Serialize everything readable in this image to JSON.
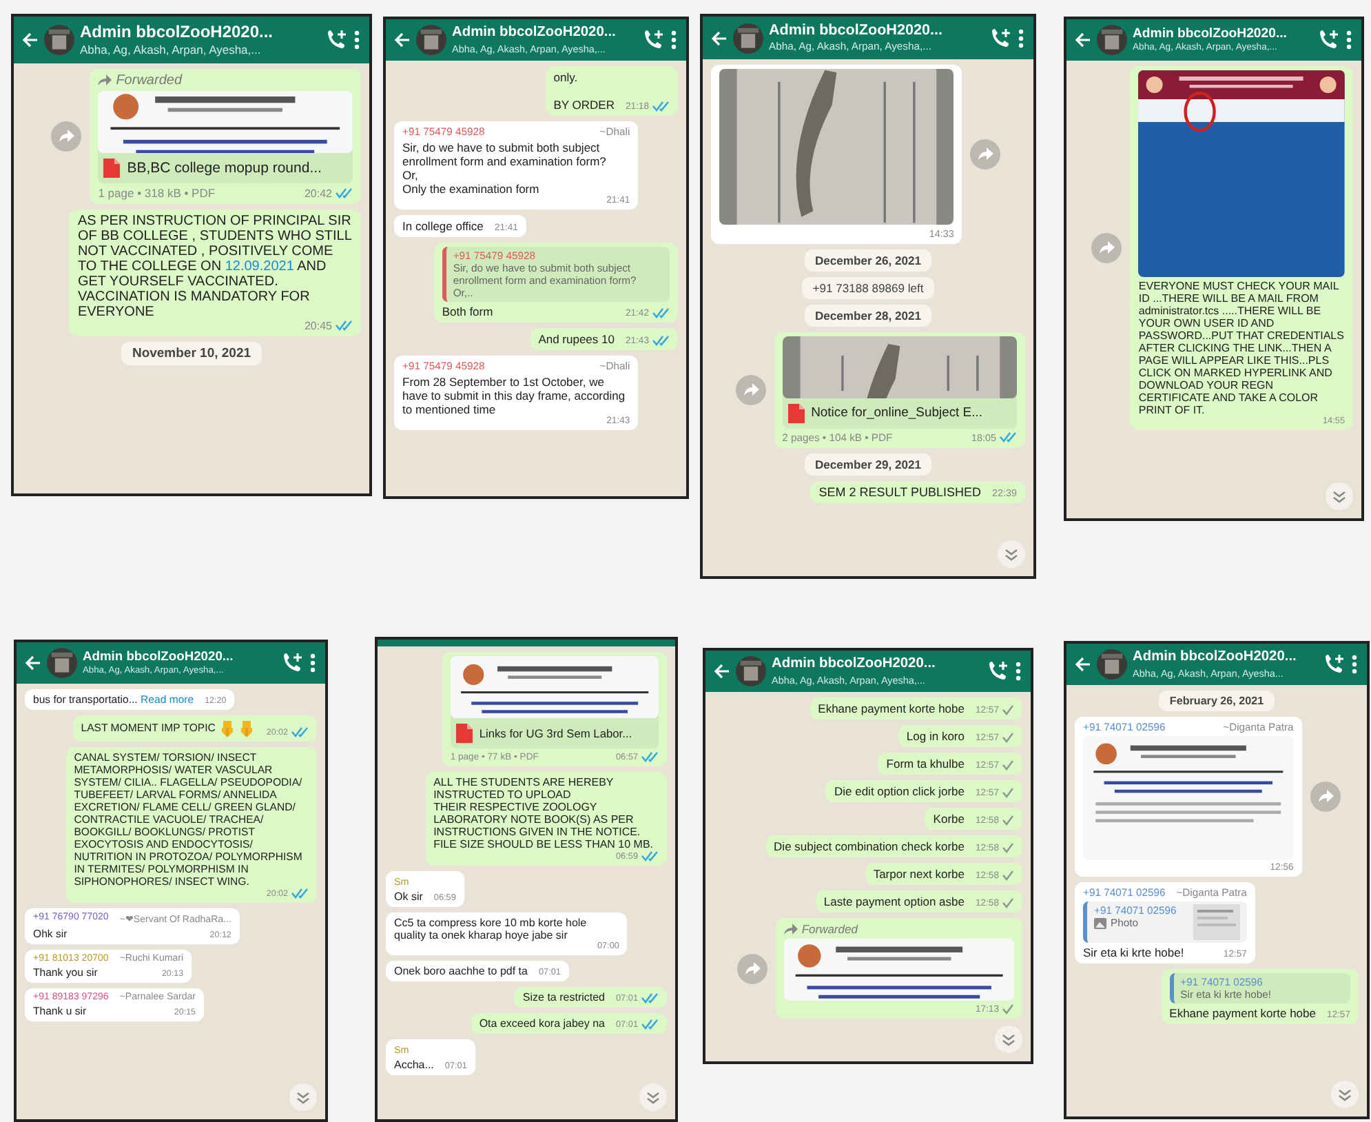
{
  "panels": [
    {
      "header": {
        "title": "Admin bbcolZooH2020...",
        "subtitle": "Abha, Ag, Akash, Arpan, Ayesha,..."
      },
      "messages": [
        {
          "kind": "message",
          "outgoing": true,
          "share_button": true,
          "forwarded": "Forwarded",
          "document": {
            "name": "BB,BC college mopup round...",
            "meta": "1 page • 318 kB • PDF"
          },
          "time": "20:42",
          "read": true
        },
        {
          "kind": "message",
          "outgoing": true,
          "segments": [
            {
              "text": "AS PER INSTRUCTION OF PRINCIPAL SIR OF BB COLLEGE , STUDENTS WHO STILL NOT VACCINATED , POSITIVELY COME TO THE COLLEGE ON "
            },
            {
              "text": "12.09.2021",
              "link": true
            },
            {
              "text": " AND GET YOURSELF VACCINATED. VACCINATION IS MANDATORY FOR EVERYONE"
            }
          ],
          "time": "20:45",
          "read": true
        },
        {
          "kind": "date",
          "text": "November 10, 2021"
        }
      ]
    },
    {
      "header": {
        "title": "Admin bbcolZooH2020...",
        "subtitle": "Abha, Ag, Akash, Arpan, Ayesha,..."
      },
      "messages": [
        {
          "kind": "message",
          "outgoing": true,
          "text": "only.\n\nBY ORDER",
          "time": "21:18",
          "read": true
        },
        {
          "kind": "message",
          "outgoing": false,
          "author": {
            "label": "+91 75479 45928",
            "alias": "~Dhali",
            "color": "#e05a5a"
          },
          "text": "Sir, do we have to submit both subject enrollment form and examination form?\nOr,\nOnly the examination form",
          "time": "21:41"
        },
        {
          "kind": "message",
          "outgoing": false,
          "text": "In college office",
          "time": "21:41"
        },
        {
          "kind": "message",
          "outgoing": true,
          "quote": {
            "author": "+91 75479 45928",
            "color": "#e05a5a",
            "text": "Sir, do we have to submit both subject enrollment form and examination form?\nOr,.."
          },
          "text": "Both form",
          "time": "21:42",
          "read": true
        },
        {
          "kind": "message",
          "outgoing": true,
          "text": "And rupees 10",
          "time": "21:43",
          "read": true
        },
        {
          "kind": "message",
          "outgoing": false,
          "author": {
            "label": "+91 75479 45928",
            "alias": "~Dhali",
            "color": "#e05a5a"
          },
          "text": "From 28 September to 1st October, we have to submit in this day frame, according to mentioned time",
          "time": "21:43"
        }
      ]
    },
    {
      "header": {
        "title": "Admin bbcolZooH2020...",
        "subtitle": "Abha, Ag, Akash, Arpan, Ayesha,..."
      },
      "scroll_down_button": true,
      "messages": [
        {
          "kind": "message",
          "outgoing": false,
          "share_button": true,
          "image": true,
          "time": "14:33"
        },
        {
          "kind": "date",
          "text": "December 26, 2021"
        },
        {
          "kind": "system",
          "text": "+91 73188 89869 left"
        },
        {
          "kind": "date",
          "text": "December 28, 2021"
        },
        {
          "kind": "message",
          "outgoing": true,
          "share_button": true,
          "document": {
            "name": "Notice for_online_Subject  E...",
            "meta": "2 pages • 104 kB • PDF"
          },
          "time": "18:05",
          "read": true
        },
        {
          "kind": "date",
          "text": "December 29, 2021"
        },
        {
          "kind": "message",
          "outgoing": true,
          "text": "SEM 2 RESULT PUBLISHED",
          "time": "22:39"
        }
      ]
    },
    {
      "header": {
        "title": "Admin bbcolZooH2020...",
        "subtitle": "Abha, Ag, Akash, Arpan, Ayesha,..."
      },
      "scroll_down_button": true,
      "messages": [
        {
          "kind": "message",
          "outgoing": true,
          "share_button": true,
          "image": true,
          "text": "EVERYONE MUST CHECK YOUR MAIL ID ...THERE WILL BE A MAIL FROM administrator.tcs .....THERE WILL BE YOUR OWN USER ID AND PASSWORD...PUT THAT CREDENTIALS AFTER CLICKING THE LINK...THEN A PAGE WILL APPEAR LIKE THIS...PLS CLICK ON MARKED HYPERLINK AND DOWNLOAD YOUR REGN CERTIFICATE AND TAKE A COLOR PRINT OF IT.",
          "time": "14:55"
        }
      ]
    },
    {
      "header": {
        "title": "Admin bbcolZooH2020...",
        "subtitle": "Abha, Ag, Akash, Arpan, Ayesha,..."
      },
      "scroll_down_button": true,
      "messages": [
        {
          "kind": "message",
          "outgoing": false,
          "segments": [
            {
              "text": "bus for transportatio... "
            },
            {
              "text": "Read more",
              "link": true
            }
          ],
          "time": "12:20"
        },
        {
          "kind": "message",
          "outgoing": true,
          "text": "LAST MOMENT IMP TOPIC",
          "pointing_hands": true,
          "time": "20:02",
          "read": true
        },
        {
          "kind": "message",
          "outgoing": true,
          "text": "CANAL SYSTEM/ TORSION/ INSECT METAMORPHOSIS/ WATER VASCULAR SYSTEM/ CILIA.. FLAGELLA/ PSEUDOPODIA/ TUBEFEET/ LARVAL FORMS/ ANNELIDA EXCRETION/ FLAME CELL/ GREEN GLAND/ CONTRACTILE VACUOLE/ TRACHEA/ BOOKGILL/ BOOKLUNGS/ PROTIST EXOCYTOSIS AND ENDOCYTOSIS/ NUTRITION IN PROTOZOA/ POLYMORPHISM IN TERMITES/ POLYMORPHISM IN SIPHONOPHORES/ INSECT WING.",
          "time": "20:02",
          "read": true
        },
        {
          "kind": "message",
          "outgoing": false,
          "author": {
            "label": "+91 76790 77020",
            "alias": "~❤Servant Of RadhaRa...",
            "color": "#7b5cc4"
          },
          "text": "Ohk sir",
          "time": "20:12"
        },
        {
          "kind": "message",
          "outgoing": false,
          "author": {
            "label": "+91 81013 20700",
            "alias": "~Ruchi Kumari",
            "color": "#b59a2a"
          },
          "text": "Thank you sir",
          "time": "20:13"
        },
        {
          "kind": "message",
          "outgoing": false,
          "author": {
            "label": "+91 89183 97296",
            "alias": "~Parnalee Sardar",
            "color": "#d9527a"
          },
          "text": "Thank u sir",
          "time": "20:15"
        }
      ]
    },
    {
      "scroll_down_button": true,
      "messages": [
        {
          "kind": "message",
          "outgoing": true,
          "document": {
            "name": "Links for UG 3rd Sem Labor...",
            "meta": "1 page • 77 kB • PDF"
          },
          "time": "06:57",
          "read": true
        },
        {
          "kind": "message",
          "outgoing": true,
          "text": "ALL THE STUDENTS ARE HEREBY INSTRUCTED TO UPLOAD\nTHEIR RESPECTIVE ZOOLOGY LABORATORY NOTE BOOK(S) AS PER INSTRUCTIONS GIVEN IN THE NOTICE. FILE SIZE SHOULD BE LESS THAN 10 MB.",
          "time": "06:59",
          "read": true
        },
        {
          "kind": "message",
          "outgoing": false,
          "author": {
            "label": "Sm",
            "color": "#b59a2a"
          },
          "text": "Ok sir",
          "time": "06:59"
        },
        {
          "kind": "message",
          "outgoing": false,
          "text": "Cc5 ta compress kore 10 mb korte hole quality ta onek kharap hoye jabe sir",
          "time": "07:00"
        },
        {
          "kind": "message",
          "outgoing": false,
          "text": "Onek boro aachhe to pdf ta",
          "time": "07:01"
        },
        {
          "kind": "message",
          "outgoing": true,
          "text": "Size ta restricted",
          "time": "07:01",
          "read": true
        },
        {
          "kind": "message",
          "outgoing": true,
          "text": "Ota exceed kora jabey na",
          "time": "07:01",
          "read": true
        },
        {
          "kind": "message",
          "outgoing": false,
          "author": {
            "label": "Sm",
            "color": "#b59a2a"
          },
          "text": "Accha...",
          "time": "07:01"
        }
      ]
    },
    {
      "header": {
        "title": "Admin bbcolZooH2020...",
        "subtitle": "Abha, Ag, Akash, Arpan, Ayesha,..."
      },
      "scroll_down_button": true,
      "messages": [
        {
          "kind": "message",
          "outgoing": true,
          "text": "Ekhane payment korte hobe",
          "time": "12:57",
          "read": false
        },
        {
          "kind": "message",
          "outgoing": true,
          "text": "Log in koro",
          "time": "12:57",
          "read": false
        },
        {
          "kind": "message",
          "outgoing": true,
          "text": "Form ta khulbe",
          "time": "12:57",
          "read": false
        },
        {
          "kind": "message",
          "outgoing": true,
          "text": "Die edit option click jorbe",
          "time": "12:57",
          "read": false
        },
        {
          "kind": "message",
          "outgoing": true,
          "text": "Korbe",
          "time": "12:58",
          "read": false
        },
        {
          "kind": "message",
          "outgoing": true,
          "text": "Die subject combination check korbe",
          "time": "12:58",
          "read": false
        },
        {
          "kind": "message",
          "outgoing": true,
          "text": "Tarpor next korbe",
          "time": "12:58",
          "read": false
        },
        {
          "kind": "message",
          "outgoing": true,
          "text": "Laste payment option asbe",
          "time": "12:58",
          "read": false
        },
        {
          "kind": "message",
          "outgoing": true,
          "share_button": true,
          "forwarded": "Forwarded",
          "image": true,
          "time": "17:13",
          "read": false
        }
      ]
    },
    {
      "header": {
        "title": "Admin bbcolZooH2020...",
        "subtitle": "Abha, Ag, Akash, Arpan, Ayesha..."
      },
      "scroll_down_button": true,
      "messages": [
        {
          "kind": "date",
          "text": "February 26, 2021"
        },
        {
          "kind": "message",
          "outgoing": false,
          "share_button": true,
          "author": {
            "label": "+91 74071 02596",
            "alias": "~Diganta Patra",
            "color": "#5a8fd0"
          },
          "image": true,
          "time": "12:56"
        },
        {
          "kind": "message",
          "outgoing": false,
          "author": {
            "label": "+91 74071 02596",
            "alias": "~Diganta Patra",
            "color": "#5a8fd0"
          },
          "quote": {
            "author": "+91 74071 02596",
            "color": "#5a8fd0",
            "text": "Photo",
            "photo": true
          },
          "text": "Sir eta ki krte hobe!",
          "time": "12:57"
        },
        {
          "kind": "message",
          "outgoing": true,
          "quote": {
            "author": "+91 74071 02596",
            "color": "#5a8fd0",
            "text": "Sir eta ki krte hobe!"
          },
          "text": "Ekhane payment korte hobe",
          "time": "12:57"
        }
      ]
    }
  ]
}
